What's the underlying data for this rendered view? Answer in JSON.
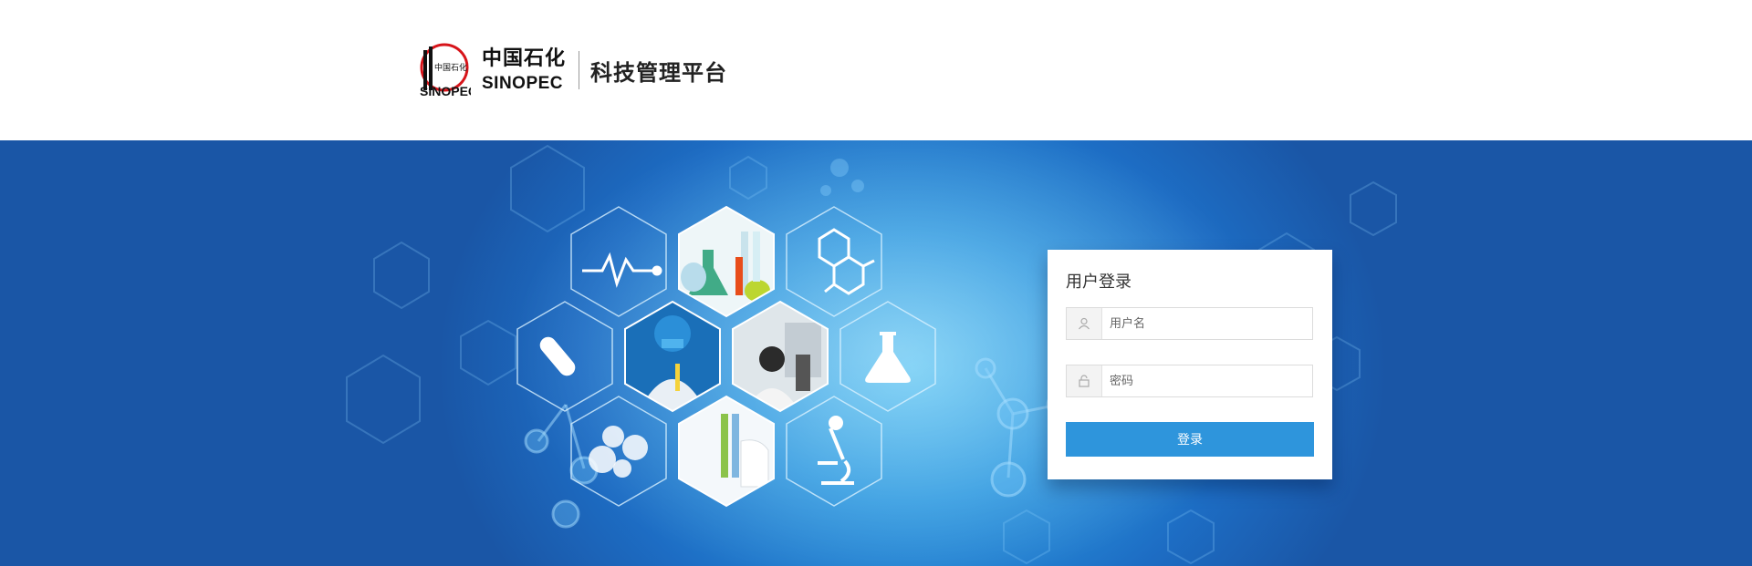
{
  "header": {
    "logo_text_cn": "中国石化",
    "logo_text_en": "SINOPEC",
    "platform_title": "科技管理平台"
  },
  "login": {
    "title": "用户登录",
    "username_placeholder": "用户名",
    "password_placeholder": "密码",
    "submit_label": "登录"
  },
  "colors": {
    "brand_red": "#d7141a",
    "banner_blue": "#1a56a6",
    "button_blue": "#2e95dc"
  },
  "icons": {
    "username": "user-icon",
    "password": "lock-icon"
  }
}
